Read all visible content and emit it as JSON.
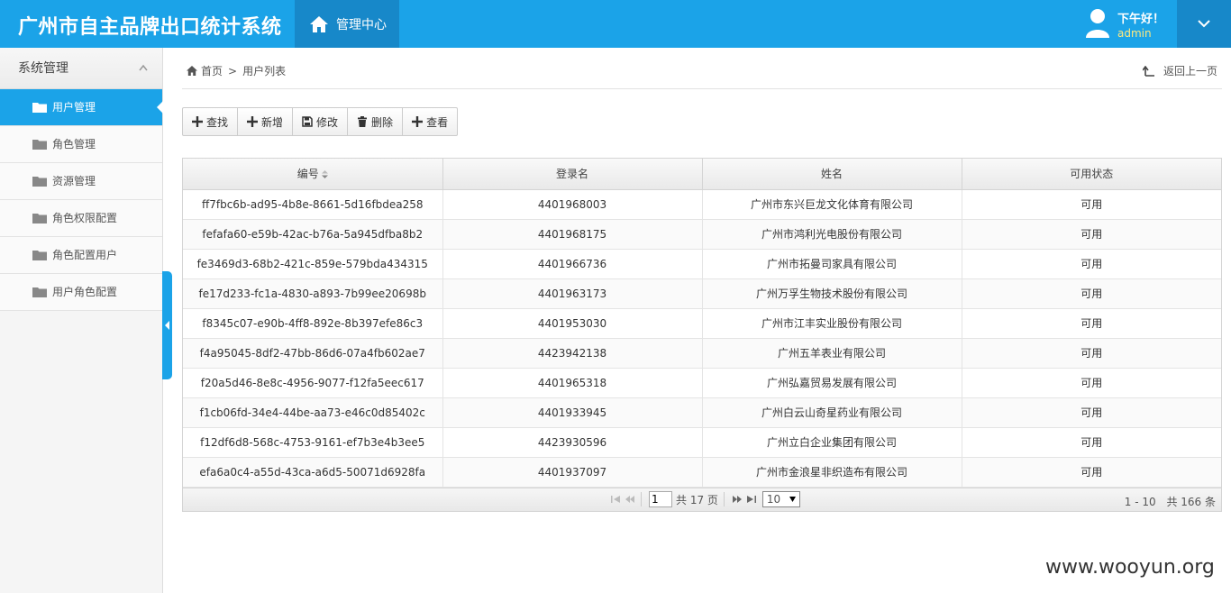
{
  "header": {
    "app_title": "广州市自主品牌出口统计系统",
    "nav_tab": "管理中心",
    "greeting": "下午好！",
    "username": "admin"
  },
  "sidebar": {
    "group": "系统管理",
    "items": [
      "用户管理",
      "角色管理",
      "资源管理",
      "角色权限配置",
      "角色配置用户",
      "用户角色配置"
    ],
    "active_index": 0
  },
  "breadcrumb": {
    "home": "首页",
    "separator": ">",
    "current": "用户列表"
  },
  "back_label": "返回上一页",
  "toolbar": [
    "查找",
    "新增",
    "修改",
    "删除",
    "查看"
  ],
  "table": {
    "columns": [
      "编号",
      "登录名",
      "姓名",
      "可用状态"
    ],
    "rows": [
      [
        "ff7fbc6b-ad95-4b8e-8661-5d16fbdea258",
        "4401968003",
        "广州市东兴巨龙文化体育有限公司",
        "可用"
      ],
      [
        "fefafa60-e59b-42ac-b76a-5a945dfba8b2",
        "4401968175",
        "广州市鸿利光电股份有限公司",
        "可用"
      ],
      [
        "fe3469d3-68b2-421c-859e-579bda434315",
        "4401966736",
        "广州市拓曼司家具有限公司",
        "可用"
      ],
      [
        "fe17d233-fc1a-4830-a893-7b99ee20698b",
        "4401963173",
        "广州万孚生物技术股份有限公司",
        "可用"
      ],
      [
        "f8345c07-e90b-4ff8-892e-8b397efe86c3",
        "4401953030",
        "广州市江丰实业股份有限公司",
        "可用"
      ],
      [
        "f4a95045-8df2-47bb-86d6-07a4fb602ae7",
        "4423942138",
        "广州五羊表业有限公司",
        "可用"
      ],
      [
        "f20a5d46-8e8c-4956-9077-f12fa5eec617",
        "4401965318",
        "广州弘嘉贸易发展有限公司",
        "可用"
      ],
      [
        "f1cb06fd-34e4-44be-aa73-e46c0d85402c",
        "4401933945",
        "广州白云山奇星药业有限公司",
        "可用"
      ],
      [
        "f12df6d8-568c-4753-9161-ef7b3e4b3ee5",
        "4423930596",
        "广州立白企业集团有限公司",
        "可用"
      ],
      [
        "efa6a0c4-a55d-43ca-a6d5-50071d6928fa",
        "4401937097",
        "广州市金浪星非织造布有限公司",
        "可用"
      ]
    ]
  },
  "pager": {
    "page_value": "1",
    "total_pages_text": "共 17 页",
    "page_size": "10",
    "range_text": "1 - 10",
    "total_text": "共 166 条"
  },
  "watermark": "www.wooyun.org",
  "colors": {
    "brand": "#1ba3e8",
    "brand_dark": "#1788c9",
    "username": "#ffe97f"
  }
}
